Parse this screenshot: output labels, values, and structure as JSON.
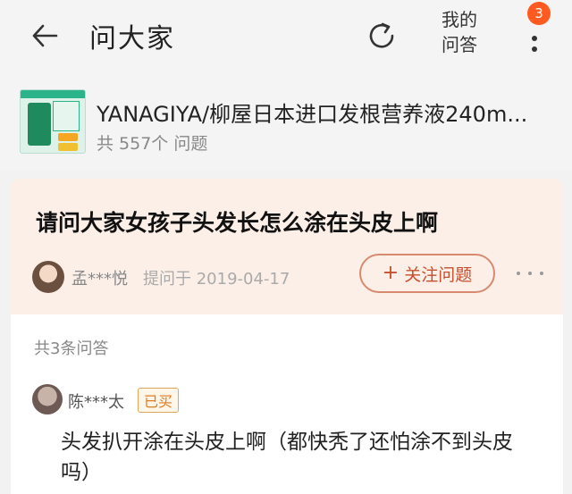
{
  "header": {
    "title": "问大家",
    "my_answers_line1": "我的",
    "my_answers_line2": "问答",
    "badge_count": "3",
    "icons": [
      "back-arrow-icon",
      "refresh-icon",
      "more-icon"
    ]
  },
  "product": {
    "name": "YANAGIYA/柳屋日本进口发根营养液240m...",
    "count_text": "共 557个 问题"
  },
  "question": {
    "title": "请问大家女孩子头发长怎么涂在头皮上啊",
    "asker": "孟***悦",
    "asked_date": "提问于 2019-04-17",
    "follow_label": "关注问题"
  },
  "answers": {
    "count_text": "共3条问答",
    "items": [
      {
        "name": "陈***太",
        "badge": "已买",
        "text": "头发扒开涂在头皮上啊（都快秃了还怕涂不到头皮吗）"
      }
    ]
  },
  "colors": {
    "accent": "#c74f2c",
    "badge": "#ff5a1f",
    "question_bg": "#fbefe8"
  }
}
